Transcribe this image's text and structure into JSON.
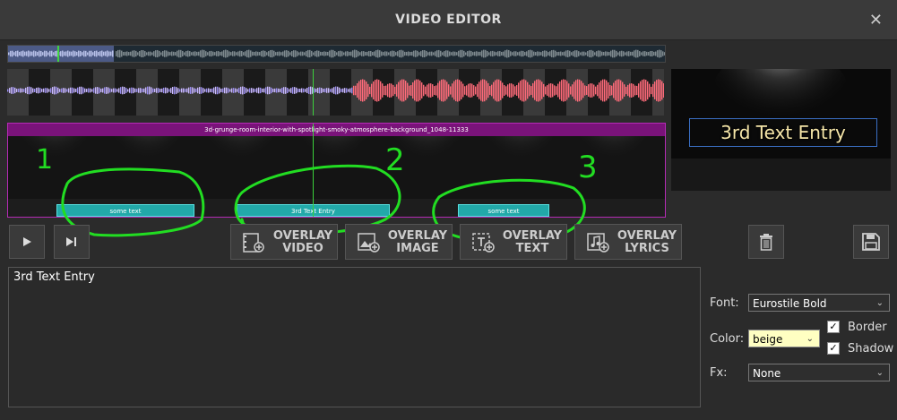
{
  "window": {
    "title": "VIDEO EDITOR",
    "close_icon": "close-icon"
  },
  "track": {
    "header": "3d-grunge-room-interior-with-spotlight-smoky-atmosphere-background_1048-11333",
    "clips": [
      "some text",
      "3rd Text Entry",
      "some text"
    ],
    "annotations": [
      "1",
      "2",
      "3"
    ]
  },
  "preview": {
    "text": "3rd Text Entry"
  },
  "transport": {
    "play_icon": "play-icon",
    "skip_end_icon": "skip-to-end-icon"
  },
  "overlay_buttons": [
    {
      "line1": "OVERLAY",
      "line2": "VIDEO",
      "icon": "film-add-icon"
    },
    {
      "line1": "OVERLAY",
      "line2": "IMAGE",
      "icon": "image-add-icon"
    },
    {
      "line1": "OVERLAY",
      "line2": "TEXT",
      "icon": "text-add-icon"
    },
    {
      "line1": "OVERLAY",
      "line2": "LYRICS",
      "icon": "music-add-icon"
    }
  ],
  "actions": {
    "delete_icon": "trash-icon",
    "save_icon": "save-icon"
  },
  "editor": {
    "text": "3rd Text Entry"
  },
  "properties": {
    "font_label": "Font:",
    "font_value": "Eurostile Bold",
    "color_label": "Color:",
    "color_value": "beige",
    "border_label": "Border",
    "border_checked": true,
    "shadow_label": "Shadow",
    "shadow_checked": true,
    "fx_label": "Fx:",
    "fx_value": "None"
  },
  "colors": {
    "accent_track": "#7a137a",
    "clip": "#22a9a9",
    "cursor": "#3bd13b",
    "annotation": "#22dd22"
  }
}
